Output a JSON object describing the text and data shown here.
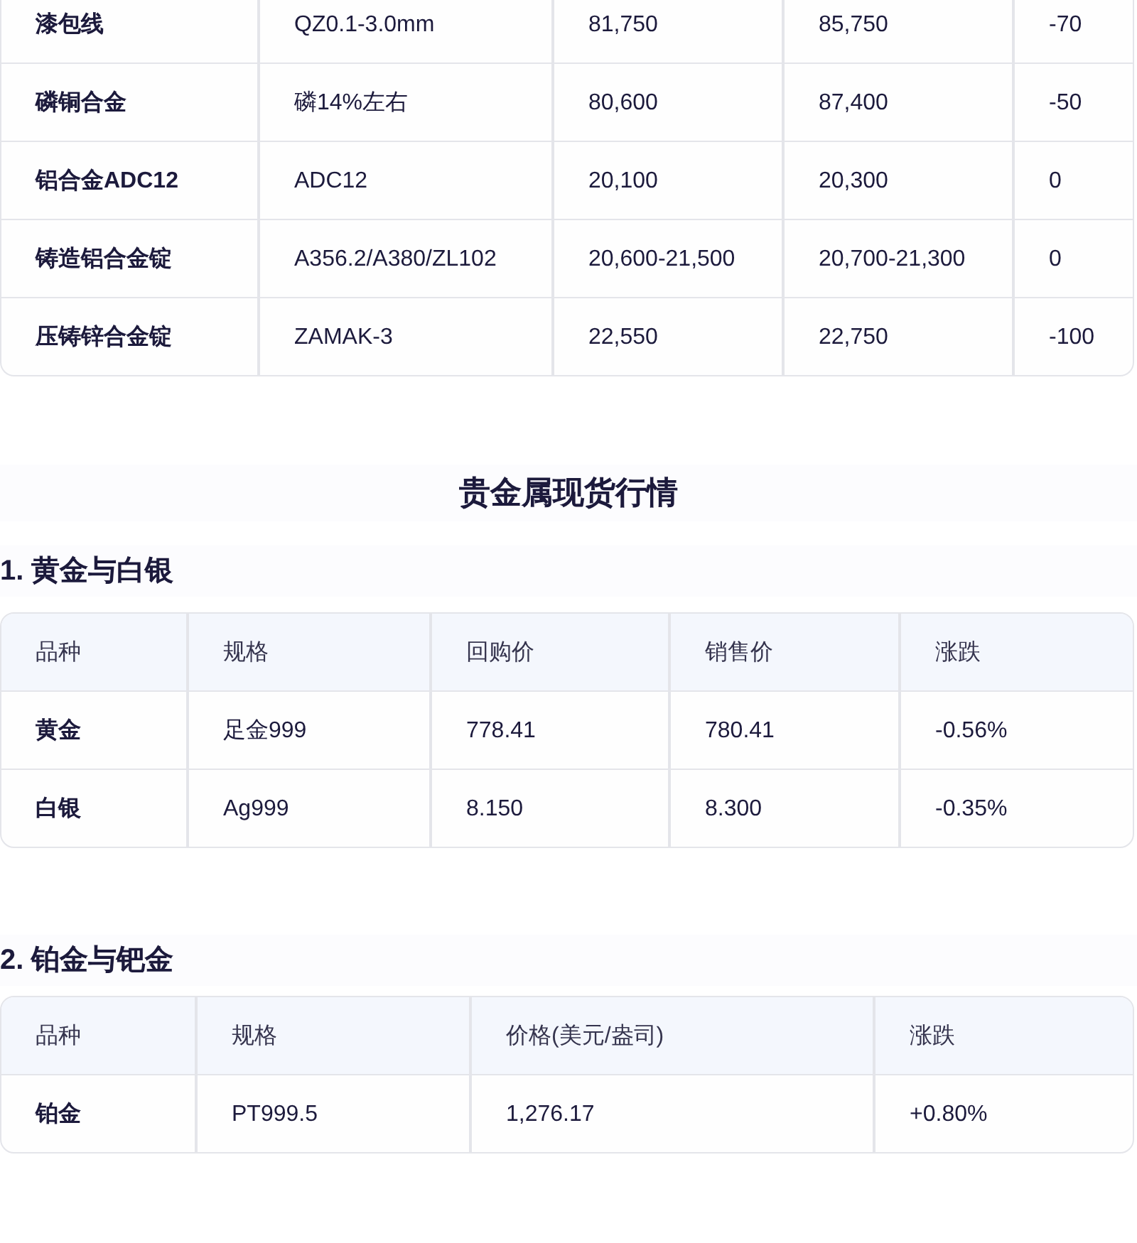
{
  "commodity_table": {
    "rows": [
      [
        "漆包线",
        "QZ0.1-3.0mm",
        "81,750",
        "85,750",
        "-70"
      ],
      [
        "磷铜合金",
        "磷14%左右",
        "80,600",
        "87,400",
        "-50"
      ],
      [
        "铝合金ADC12",
        "ADC12",
        "20,100",
        "20,300",
        "0"
      ],
      [
        "铸造铝合金锭",
        "A356.2/A380/ZL102",
        "20,600-21,500",
        "20,700-21,300",
        "0"
      ],
      [
        "压铸锌合金锭",
        "ZAMAK-3",
        "22,550",
        "22,750",
        "-100"
      ]
    ]
  },
  "precious_metals": {
    "title": "贵金属现货行情",
    "sections": [
      {
        "heading": "1. 黄金与白银",
        "table": {
          "columns": [
            "品种",
            "规格",
            "回购价",
            "销售价",
            "涨跌"
          ],
          "rows": [
            [
              "黄金",
              "足金999",
              "778.41",
              "780.41",
              "-0.56%"
            ],
            [
              "白银",
              "Ag999",
              "8.150",
              "8.300",
              "-0.35%"
            ]
          ]
        }
      },
      {
        "heading": "2. 铂金与钯金",
        "table": {
          "columns": [
            "品种",
            "规格",
            "价格(美元/盎司)",
            "涨跌"
          ],
          "rows": [
            [
              "铂金",
              "PT999.5",
              "1,276.17",
              "+0.80%"
            ]
          ]
        }
      }
    ]
  }
}
